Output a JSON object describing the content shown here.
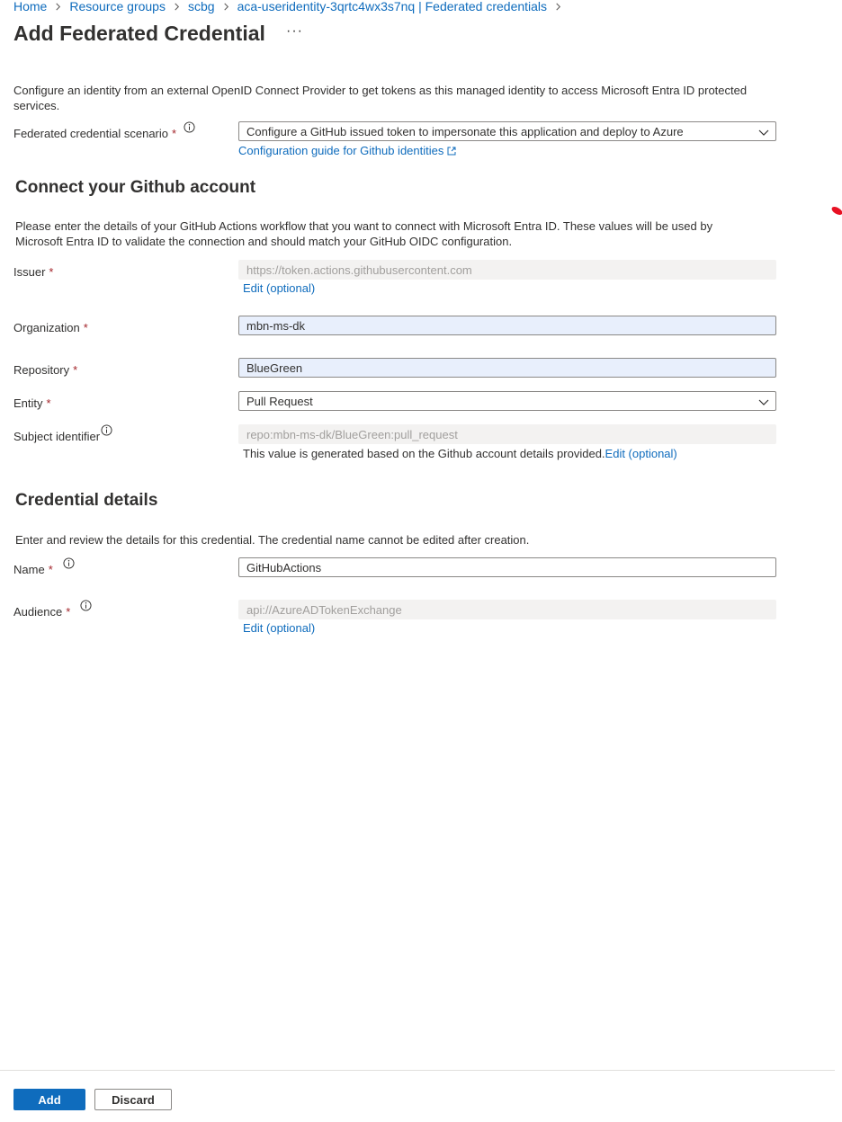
{
  "breadcrumb": [
    {
      "label": "Home"
    },
    {
      "label": "Resource groups"
    },
    {
      "label": "scbg"
    },
    {
      "label": "aca-useridentity-3qrtc4wx3s7nq | Federated credentials"
    }
  ],
  "page": {
    "title": "Add Federated Credential",
    "more": "···",
    "description": "Configure an identity from an external OpenID Connect Provider to get tokens as this managed identity to access Microsoft Entra ID protected services."
  },
  "scenario": {
    "label": "Federated credential scenario",
    "required": "*",
    "value": "Configure a GitHub issued token to impersonate this application and deploy to Azure",
    "guide_link": "Configuration guide for Github identities"
  },
  "github": {
    "title": "Connect your Github account",
    "description": "Please enter the details of your GitHub Actions workflow that you want to connect with Microsoft Entra ID. These values will be used by Microsoft Entra ID to validate the connection and should match your GitHub OIDC configuration.",
    "issuer": {
      "label": "Issuer",
      "required": "*",
      "value": "https://token.actions.githubusercontent.com",
      "edit": "Edit (optional)"
    },
    "organization": {
      "label": "Organization",
      "required": "*",
      "value": "mbn-ms-dk"
    },
    "repository": {
      "label": "Repository",
      "required": "*",
      "value": "BlueGreen"
    },
    "entity": {
      "label": "Entity",
      "required": "*",
      "value": "Pull Request"
    },
    "subject": {
      "label": "Subject identifier",
      "value": "repo:mbn-ms-dk/BlueGreen:pull_request",
      "helper": "This value is generated based on the Github account details provided.",
      "edit": "Edit (optional)"
    }
  },
  "credential": {
    "title": "Credential details",
    "description": "Enter and review the details for this credential. The credential name cannot be edited after creation.",
    "name": {
      "label": "Name",
      "required": "*",
      "value": "GitHubActions"
    },
    "audience": {
      "label": "Audience",
      "required": "*",
      "value": "api://AzureADTokenExchange",
      "edit": "Edit (optional)"
    }
  },
  "footer": {
    "add": "Add",
    "discard": "Discard"
  },
  "colors": {
    "accent": "#0f6cbd",
    "required": "#a4262c",
    "filled_field": "#e8effc",
    "disabled_field": "#f3f2f1"
  }
}
